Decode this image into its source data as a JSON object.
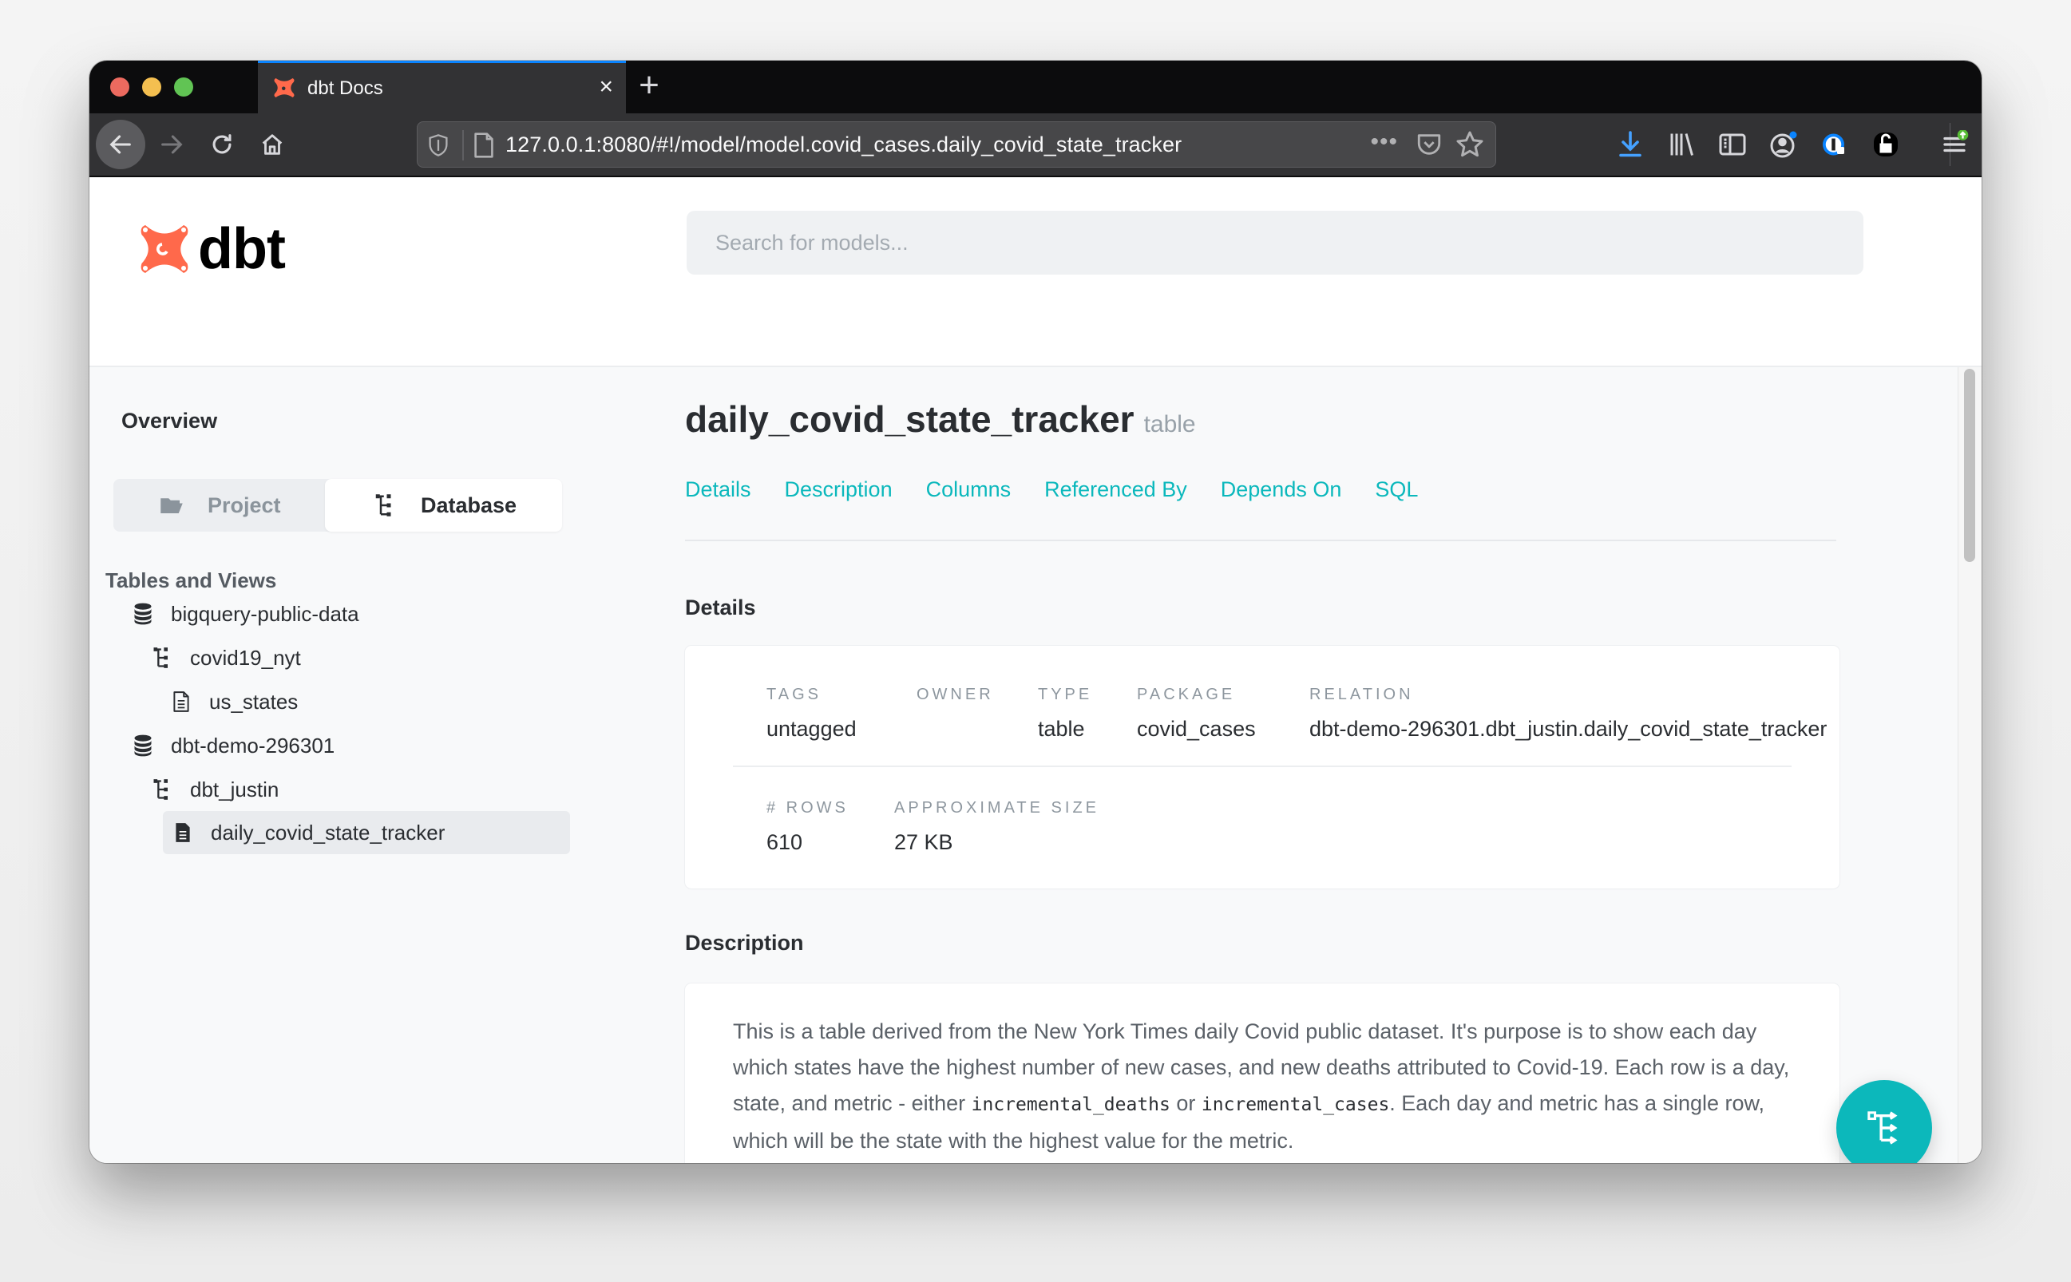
{
  "browser": {
    "tab_title": "dbt Docs",
    "tab_close_label": "×",
    "new_tab_label": "+",
    "url": "127.0.0.1:8080/#!/model/model.covid_cases.daily_covid_state_tracker",
    "more_label": "•••",
    "toolbar_icons": [
      "download-icon",
      "library-icon",
      "sidebar-icon",
      "account-icon",
      "password-manager-icon",
      "lock-extension-icon",
      "menu-icon"
    ],
    "accent_color": "#0a84ff"
  },
  "app": {
    "logo_text": "dbt",
    "brand_color": "#ff694b",
    "accent_color": "#0bb8bc",
    "search": {
      "placeholder": "Search for models...",
      "value": ""
    }
  },
  "sidebar": {
    "overview_label": "Overview",
    "switch": {
      "project_label": "Project",
      "database_label": "Database",
      "selected": "Database"
    },
    "section_title": "Tables and Views",
    "tree": [
      {
        "label": "bigquery-public-data",
        "icon": "database-icon",
        "level": 0
      },
      {
        "label": "covid19_nyt",
        "icon": "schema-tree-icon",
        "level": 1
      },
      {
        "label": "us_states",
        "icon": "table-file-icon",
        "level": 2
      },
      {
        "label": "dbt-demo-296301",
        "icon": "database-icon",
        "level": 0
      },
      {
        "label": "dbt_justin",
        "icon": "schema-tree-icon",
        "level": 1
      },
      {
        "label": "daily_covid_state_tracker",
        "icon": "table-file-icon",
        "level": 2,
        "active": true
      }
    ]
  },
  "main": {
    "model_name": "daily_covid_state_tracker",
    "model_type": "table",
    "tabs": [
      "Details",
      "Description",
      "Columns",
      "Referenced By",
      "Depends On",
      "SQL"
    ],
    "details": {
      "heading": "Details",
      "row1": [
        {
          "label": "Tags",
          "value": "untagged"
        },
        {
          "label": "Owner",
          "value": ""
        },
        {
          "label": "Type",
          "value": "table"
        },
        {
          "label": "Package",
          "value": "covid_cases"
        },
        {
          "label": "Relation",
          "value": "dbt-demo-296301.dbt_justin.daily_covid_state_tracker"
        }
      ],
      "row2": [
        {
          "label": "# Rows",
          "value": "610"
        },
        {
          "label": "Approximate Size",
          "value": "27 KB"
        }
      ]
    },
    "description": {
      "heading": "Description",
      "part1": "This is a table derived from the New York Times daily Covid public dataset. It's purpose is to show each day which states have the highest number of new cases, and new deaths attributed to Covid-19. Each row is a day, state, and metric - either ",
      "code1": "incremental_deaths",
      "part2": " or ",
      "code2": "incremental_cases",
      "part3": ". Each day and metric has a single row, which will be the state with the highest value for the metric."
    }
  },
  "fab": {
    "icon": "lineage-graph-icon"
  }
}
